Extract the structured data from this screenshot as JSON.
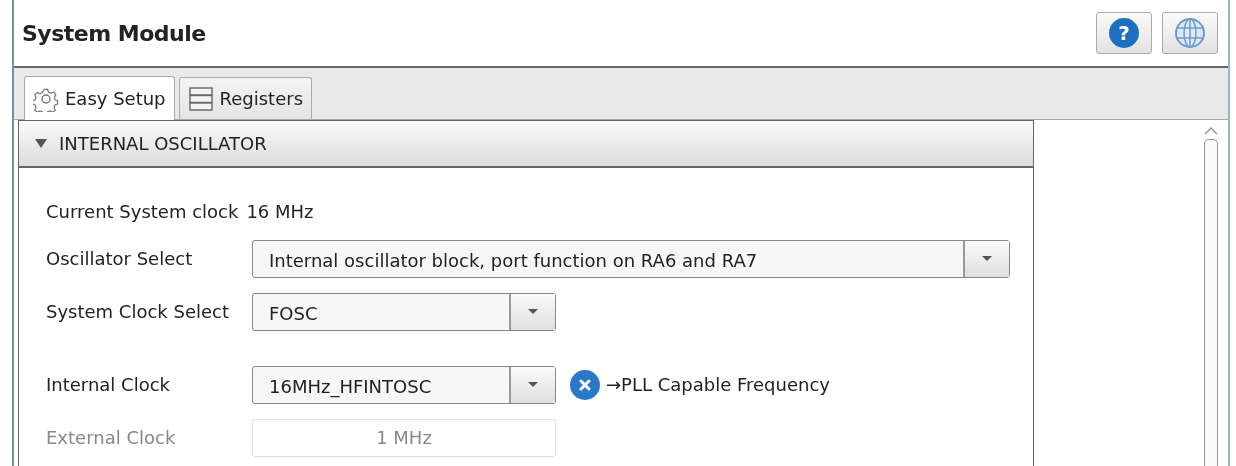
{
  "window": {
    "title": "System Module"
  },
  "toolbar": [
    {
      "kind": "help",
      "label": "?"
    },
    {
      "kind": "globe"
    }
  ],
  "tabs": [
    {
      "kind": "setup",
      "label": "Easy Setup",
      "selected": true
    },
    {
      "kind": "registers",
      "label": "Registers",
      "selected": false
    }
  ],
  "section": {
    "title": "INTERNAL OSCILLATOR",
    "expanded": true,
    "fields": [
      {
        "kind": "readout",
        "label": "Current System clock",
        "value": "16 MHz"
      },
      {
        "kind": "wide-dropdown",
        "label": "Oscillator Select",
        "value": "Internal oscillator block, port function on RA6 and RA7",
        "disabled": false
      },
      {
        "kind": "dropdown",
        "label": "System Clock Select",
        "value": "FOSC",
        "disabled": false
      },
      {
        "kind": "dropdown",
        "label": "Internal Clock",
        "value": "16MHz_HFINTOSC",
        "disabled": false,
        "note": "→PLL Capable Frequency"
      },
      {
        "kind": "input",
        "label": "External Clock",
        "value": "1 MHz",
        "disabled": true
      }
    ]
  }
}
